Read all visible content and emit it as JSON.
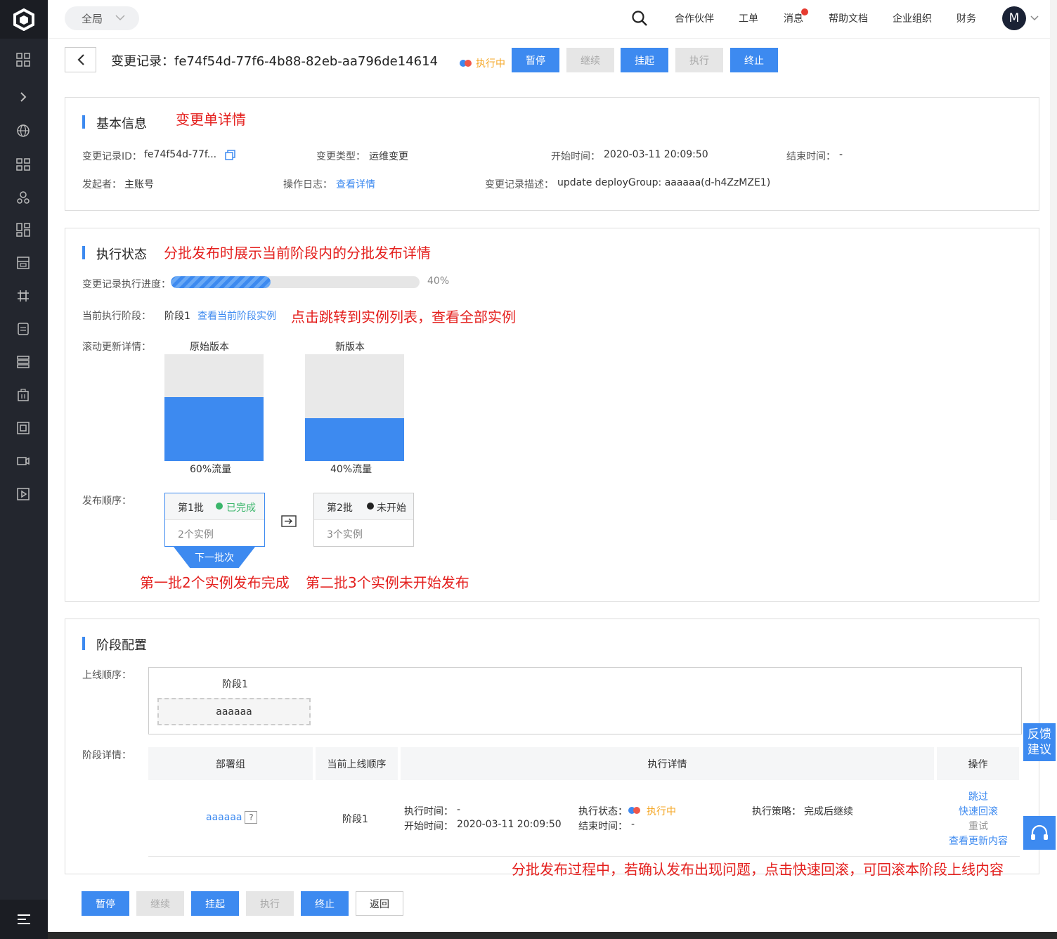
{
  "topbar": {
    "scope": "全局",
    "links": [
      "合作伙伴",
      "工单",
      "消息",
      "帮助文档",
      "企业组织",
      "财务"
    ],
    "avatar": "M"
  },
  "header": {
    "title": "变更记录：fe74f54d-77f6-4b88-82eb-aa796de14614",
    "status": "执行中",
    "buttons": [
      "暂停",
      "继续",
      "挂起",
      "执行",
      "终止"
    ]
  },
  "basic": {
    "title": "基本信息",
    "annotation": "变更单详情",
    "record_id_label": "变更记录ID：",
    "record_id": "fe74f54d-77f...",
    "type_label": "变更类型：",
    "type": "运维变更",
    "start_label": "开始时间：",
    "start": "2020-03-11 20:09:50",
    "end_label": "结束时间：",
    "end": "-",
    "initiator_label": "发起者：",
    "initiator": "主账号",
    "log_label": "操作日志：",
    "log_link": "查看详情",
    "desc_label": "变更记录描述：",
    "desc": "update deployGroup: aaaaaa(d-h4ZzMZE1)"
  },
  "exec": {
    "title": "执行状态",
    "annotation": "分批发布时展示当前阶段内的分批发布详情",
    "progress_label": "变更记录执行进度：",
    "progress": 0.4,
    "progress_text": "40%",
    "stage_label": "当前执行阶段：",
    "stage": "阶段1",
    "stage_link": "查看当前阶段实例",
    "stage_annotation": "点击跳转到实例列表，查看全部实例",
    "rolling_label": "滚动更新详情：",
    "old_title": "原始版本",
    "old_fill": 0.6,
    "old_caption": "60%流量",
    "new_title": "新版本",
    "new_fill": 0.4,
    "new_caption": "40%流量",
    "order_label": "发布顺序：",
    "batch1": {
      "name": "第1批",
      "status": "已完成",
      "count": "2个实例"
    },
    "batch2": {
      "name": "第2批",
      "status": "未开始",
      "count": "3个实例"
    },
    "next_batch": "下一批次",
    "anno_batch1": "第一批2个实例发布完成",
    "anno_batch2": "第二批3个实例未开始发布"
  },
  "stage_cfg": {
    "title": "阶段配置",
    "online_order_label": "上线顺序：",
    "stage_name": "阶段1",
    "group_name": "aaaaaa",
    "detail_label": "阶段详情：",
    "columns": [
      "部署组",
      "当前上线顺序",
      "执行详情",
      "操作"
    ],
    "row": {
      "group": "aaaaaa",
      "order": "阶段1",
      "exec_time_label": "执行时间：",
      "exec_time": "-",
      "start_label": "开始时间：",
      "start": "2020-03-11 20:09:50",
      "state_label": "执行状态：",
      "state": "执行中",
      "end_label": "结束时间：",
      "end": "-",
      "strategy_label": "执行策略：",
      "strategy": "完成后继续",
      "ops": [
        "跳过",
        "快速回滚",
        "重试",
        "查看更新内容"
      ]
    },
    "annotation": "分批发布过程中，若确认发布出现问题，点击快速回滚，可回滚本阶段上线内容"
  },
  "footer": {
    "buttons": [
      "暂停",
      "继续",
      "挂起",
      "执行",
      "终止",
      "返回"
    ]
  },
  "float": {
    "feedback_line1": "反馈",
    "feedback_line2": "建议"
  },
  "colors": {
    "primary": "#3d8af0",
    "annotation": "#e4201e",
    "success": "#3bb66b",
    "sidebar": "#23262e"
  }
}
